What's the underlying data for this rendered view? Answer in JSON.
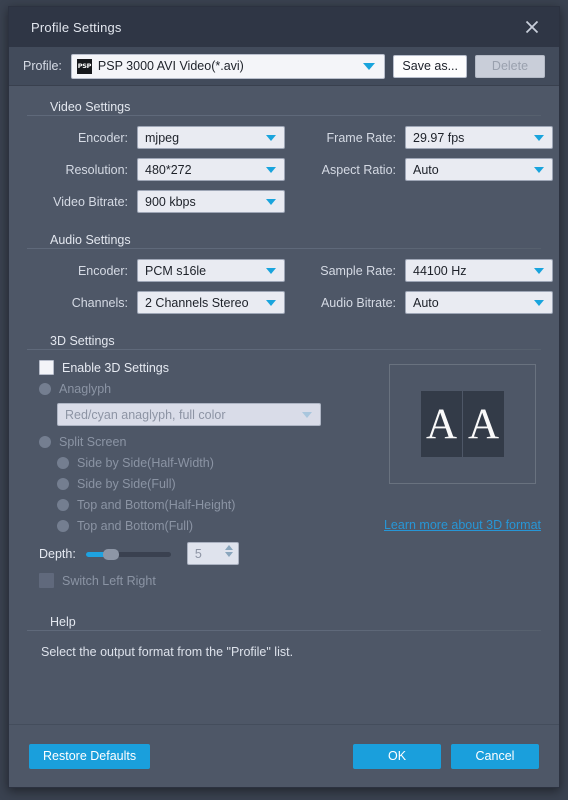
{
  "window": {
    "title": "Profile Settings",
    "close_icon": "close-icon"
  },
  "profile_row": {
    "label": "Profile:",
    "icon_text": "PSP",
    "value": "PSP 3000 AVI Video(*.avi)",
    "save_as_label": "Save as...",
    "delete_label": "Delete"
  },
  "video_settings": {
    "title": "Video Settings",
    "encoder_label": "Encoder:",
    "encoder_value": "mjpeg",
    "frame_rate_label": "Frame Rate:",
    "frame_rate_value": "29.97 fps",
    "resolution_label": "Resolution:",
    "resolution_value": "480*272",
    "aspect_ratio_label": "Aspect Ratio:",
    "aspect_ratio_value": "Auto",
    "video_bitrate_label": "Video Bitrate:",
    "video_bitrate_value": "900 kbps"
  },
  "audio_settings": {
    "title": "Audio Settings",
    "encoder_label": "Encoder:",
    "encoder_value": "PCM s16le",
    "sample_rate_label": "Sample Rate:",
    "sample_rate_value": "44100 Hz",
    "channels_label": "Channels:",
    "channels_value": "2 Channels Stereo",
    "audio_bitrate_label": "Audio Bitrate:",
    "audio_bitrate_value": "Auto"
  },
  "threed_settings": {
    "title": "3D Settings",
    "enable_label": "Enable 3D Settings",
    "anaglyph_label": "Anaglyph",
    "anaglyph_value": "Red/cyan anaglyph, full color",
    "split_screen_label": "Split Screen",
    "sbs_half_label": "Side by Side(Half-Width)",
    "sbs_full_label": "Side by Side(Full)",
    "tb_half_label": "Top and Bottom(Half-Height)",
    "tb_full_label": "Top and Bottom(Full)",
    "depth_label": "Depth:",
    "depth_value": "5",
    "switch_lr_label": "Switch Left Right",
    "preview_letter_left": "A",
    "preview_letter_right": "A",
    "learn_more_label": "Learn more about 3D format"
  },
  "help": {
    "title": "Help",
    "text": "Select the output format from the \"Profile\" list."
  },
  "footer": {
    "restore_defaults_label": "Restore Defaults",
    "ok_label": "OK",
    "cancel_label": "Cancel"
  },
  "colors": {
    "accent": "#1a9fdc",
    "window_bg": "#4e5767",
    "titlebar_bg": "#2f3645",
    "link": "#2796d6"
  }
}
